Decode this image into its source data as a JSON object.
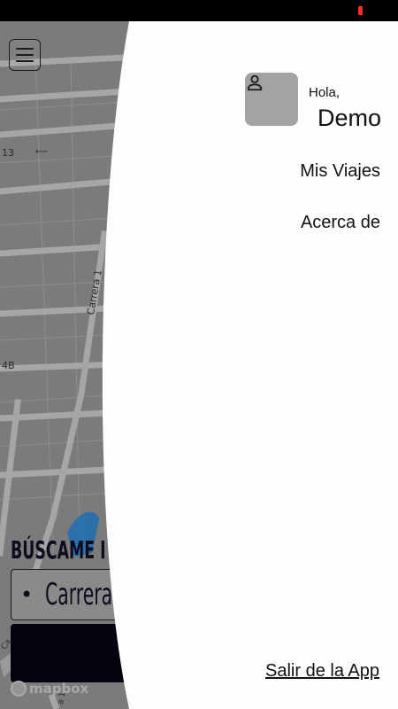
{
  "map": {
    "street_labels": [
      "13",
      "Carrera 1",
      "4B",
      "Ca",
      "a 1"
    ],
    "provider": "mapbox"
  },
  "search": {
    "title": "BÚSCAME I",
    "address_value": "Carrera",
    "bullet": "•"
  },
  "drawer": {
    "greeting": "Hola,",
    "user_name": "Demo",
    "items": [
      {
        "label": "Mis Viajes"
      },
      {
        "label": "Acerca de"
      }
    ],
    "logout_label": "Salir de la App"
  },
  "colors": {
    "drawer_bg": "#fdfdfd",
    "avatar_bg": "#a3a3a3",
    "button_dark": "#02030f",
    "status_battery": "#ff2a2a"
  }
}
